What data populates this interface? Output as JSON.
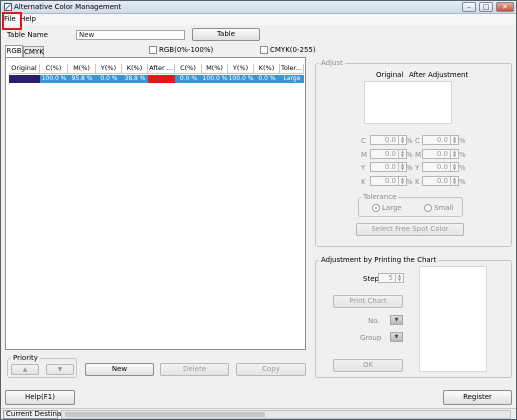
{
  "window": {
    "title": "Alternative Color Management",
    "minimize": "–",
    "maximize": "□",
    "close": "✕"
  },
  "menu": {
    "file": "File",
    "help": "Help"
  },
  "table_name": {
    "label": "Table Name",
    "value": "New",
    "table_button": "Table"
  },
  "tabs": [
    "RGB",
    "CMYK"
  ],
  "options": {
    "rgb_range": "RGB(0%-100%)",
    "cmyk_range": "CMYK(0-255)"
  },
  "grid": {
    "headers": [
      "Original",
      "C(%)",
      "M(%)",
      "Y(%)",
      "K(%)",
      "After ...",
      "C(%)",
      "M(%)",
      "Y(%)",
      "K(%)",
      "Toler..."
    ],
    "row": {
      "original_color": "#2b1f6b",
      "c": "100.0 %",
      "m": "95.8 %",
      "y": "0.0 %",
      "k": "38.8 %",
      "after_color": "#e01818",
      "c2": "0.0 %",
      "m2": "100.0 %",
      "y2": "100.0 %",
      "k2": "0.0 %",
      "tolerance": "Large",
      "selected_color": "#3b96d6"
    }
  },
  "priority": {
    "title": "Priority",
    "up": "▲",
    "down": "▼"
  },
  "list_buttons": {
    "new": "New",
    "delete": "Delete",
    "copy": "Copy"
  },
  "adjust": {
    "title": "Adjust",
    "original": "Original",
    "after": "After Adjustment",
    "channels": [
      "C",
      "M",
      "Y",
      "K"
    ],
    "value": "0.0",
    "percent": "%",
    "tolerance_title": "Tolerance",
    "large": "Large",
    "small": "Small",
    "select_spot": "Select Free Spot Color"
  },
  "chart": {
    "title": "Adjustment by Printing the Chart",
    "step_label": "Step",
    "step_value": "5",
    "print_chart": "Print Chart",
    "no_label": "No.",
    "group_label": "Group",
    "ok": "OK"
  },
  "footer": {
    "help": "Help(F1)",
    "register": "Register"
  },
  "status": {
    "label": "Current Destination"
  }
}
